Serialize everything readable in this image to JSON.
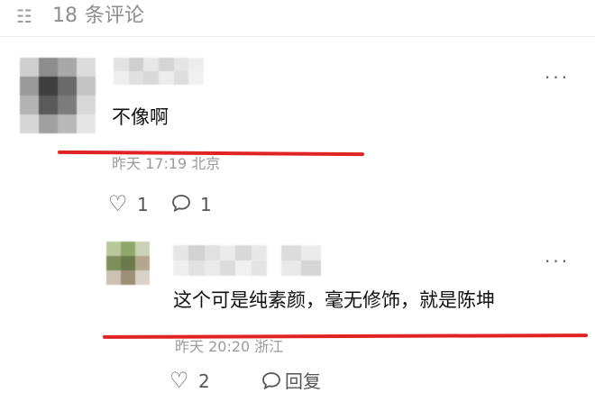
{
  "header": {
    "count": "18",
    "label": "条评论",
    "icon": "comment-list-icon"
  },
  "comments": [
    {
      "text": "不像啊",
      "meta": "昨天 17:19 北京",
      "likes": "1",
      "replies": "1",
      "more": "···"
    },
    {
      "text": "这个可是纯素颜，毫无修饰，就是陈坤",
      "meta": "昨天 20:20 浙江",
      "likes": "2",
      "reply_label": "回复",
      "more": "···"
    }
  ],
  "colors": {
    "highlight": "#e02424",
    "meta_text": "#9b9b9b"
  }
}
